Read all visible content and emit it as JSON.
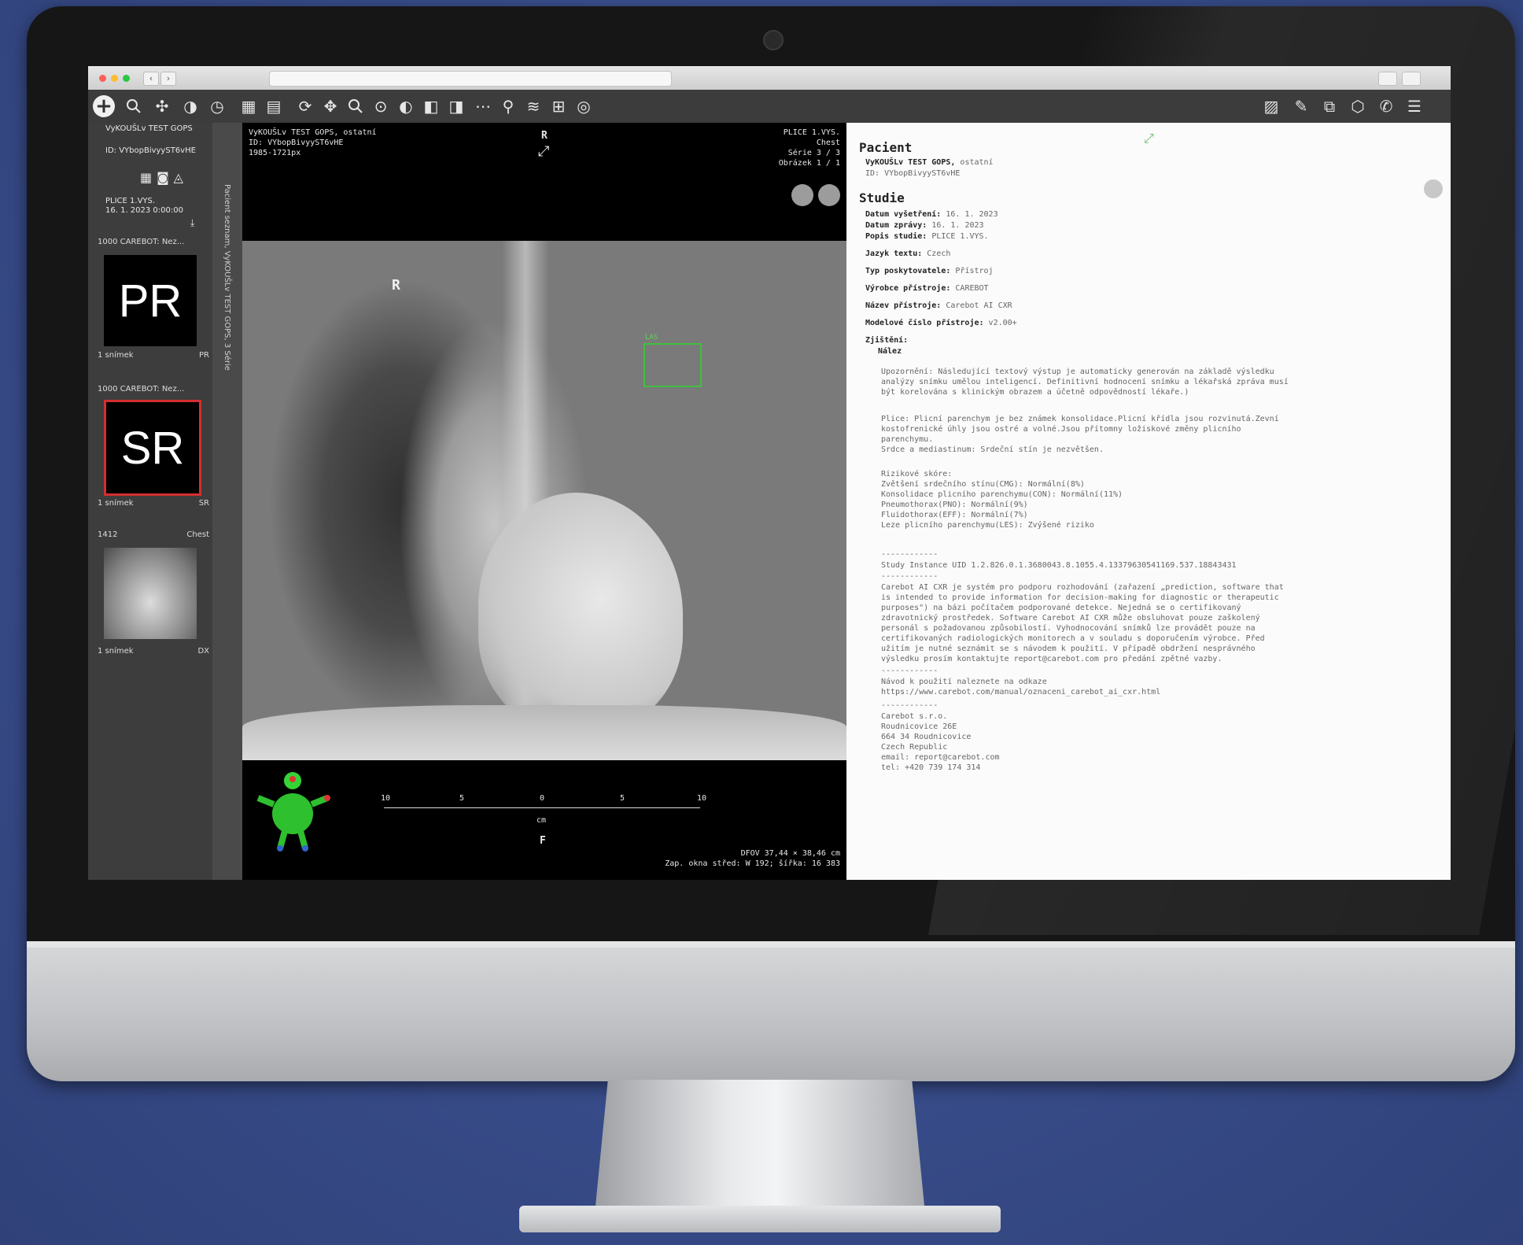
{
  "viewer": {
    "patient_name_short": "VyKOUŠLv TEST GOPS",
    "patient_id_short": "ID: VYbopBivyyST6vHE",
    "series_label": "PLICE 1.VYS.",
    "series_date": "16. 1. 2023 0:00:00",
    "thumbs": [
      {
        "header": "1000 CAREBOT: Nez...",
        "badge": "PR",
        "count": "1 snímek",
        "modality": "PR"
      },
      {
        "header": "1000 CAREBOT: Nez...",
        "badge": "SR",
        "count": "1 snímek",
        "modality": "SR"
      },
      {
        "header_left": "1412",
        "header_right": "Chest",
        "count": "1 snímek",
        "modality": "DX"
      }
    ],
    "side_vertical_text": "Pacient seznam, VyKOUŠLv TEST GOPS, 3 Série",
    "overlay_top_left": [
      "VyKOUŠLv TEST GOPS, ostatní",
      "ID: VYbopBivyyST6vHE",
      "1985-1721px"
    ],
    "overlay_top_right": [
      "PLICE 1.VYS.",
      "Chest",
      "Série 3 / 3",
      "Obrázek 1 / 1"
    ],
    "marker_top": "R",
    "marker_side": "R",
    "marker_bottom": "F",
    "finding_label": "LAS",
    "ruler_ticks": [
      "10",
      "5",
      "0",
      "5",
      "10"
    ],
    "ruler_unit": "cm",
    "overlay_bottom_right": [
      "DFOV 37,44 × 38,46 cm",
      "Zap. okna střed: W 192; šířka: 16 383"
    ]
  },
  "report": {
    "pacient_heading": "Pacient",
    "pacient_name": "VyKOUŠLv TEST GOPS,",
    "pacient_name_suffix": "ostatní",
    "pacient_id": "ID: VYbopBivyyST6vHE",
    "studie_heading": "Studie",
    "fields": [
      {
        "label": "Datum vyšetření:",
        "value": "16. 1. 2023"
      },
      {
        "label": "Datum zprávy:",
        "value": "16. 1. 2023"
      },
      {
        "label": "Popis studie:",
        "value": "PLICE 1.VYS."
      },
      {
        "label": "Jazyk textu:",
        "value": "Czech"
      },
      {
        "label": "Typ poskytovatele:",
        "value": "Přístroj"
      },
      {
        "label": "Výrobce přístroje:",
        "value": "CAREBOT"
      },
      {
        "label": "Název přístroje:",
        "value": "Carebot AI CXR"
      },
      {
        "label": "Modelové číslo přístroje:",
        "value": "v2.00+"
      }
    ],
    "zjisteni_label": "Zjištění:",
    "nalez_label": "Nález",
    "upozorneni": "Upozornění: Následující textový výstup je automaticky generován na základě výsledku\nanalýzy snímku umělou inteligencí. Definitivní hodnocení snímku a lékařská zpráva musí\nbýt korelována s klinickým obrazem a účetně odpovědností lékaře.)",
    "plice": "Plice: Plicní parenchym je bez známek konsolidace.Plicní křídla jsou rozvinutá.Zevní\nkostofrenické úhly jsou ostré a volné.Jsou přítomny ložiskové změny plicního\nparenchymu.\nSrdce a mediastinum: Srdeční stín je nezvětšen.",
    "rizikove": "Rizikové skóre:\nZvětšení srdečního stínu(CMG): Normální(8%)\nKonsolidace plicního parenchymu(CON): Normální(11%)\nPneumothorax(PNO): Normální(9%)\nFluidothorax(EFF): Normální(7%)\nLeze plicního parenchymu(LES): Zvýšené riziko",
    "separator": "------------",
    "study_uid": "Study Instance UID 1.2.826.0.1.3680043.8.1055.4.13379630541169.537.18843431",
    "disclaimer": "Carebot AI CXR je systém pro podporu rozhodování (zařazení „prediction, software that\nis intended to provide information for decision-making for diagnostic or therapeutic\npurposes\") na bázi počítačem podporované detekce. Nejedná se o certifikovaný\nzdravotnický prostředek. Software Carebot AI CXR může obsluhovat pouze zaškolený\npersonál s požadovanou způsobilostí. Vyhodnocování snímků lze provádět pouze na\ncertifikovaných radiologických monitorech a v souladu s doporučením výrobce. Před\nužitím je nutné seznámit se s návodem k použití. V případě obdržení nesprávného\nvýsledku prosím kontaktujte report@carebot.com pro předání zpětné vazby.",
    "manual": "Návod k použití naleznete na odkaze\nhttps://www.carebot.com/manual/oznaceni_carebot_ai_cxr.html",
    "company": "Carebot s.r.o.\nRoudnicovice 26E\n664 34 Roudnicovice\nCzech Republic\nemail: report@carebot.com\ntel: +420 739 174 314"
  }
}
